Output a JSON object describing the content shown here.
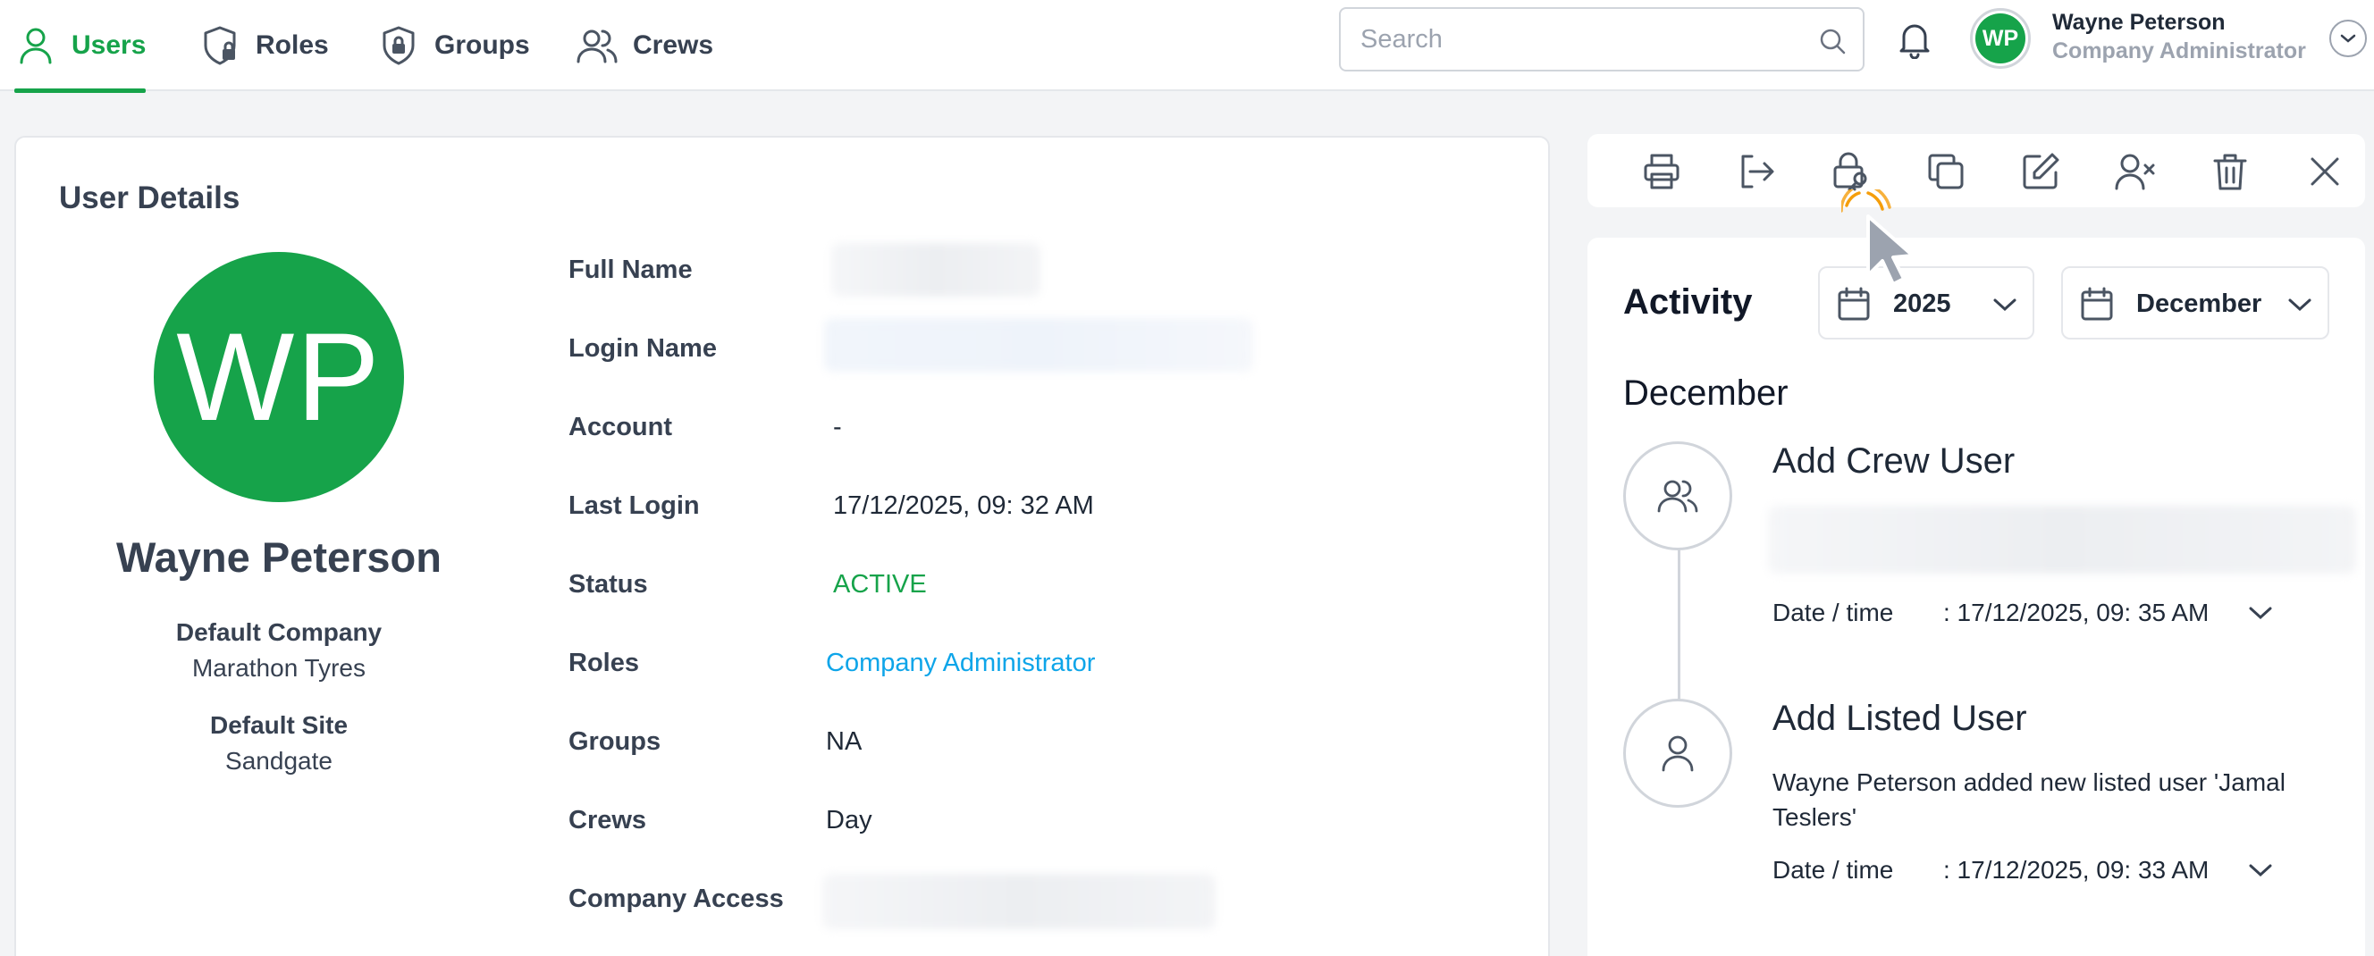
{
  "nav": {
    "tabs": [
      {
        "label": "Users",
        "icon": "user-icon",
        "active": true
      },
      {
        "label": "Roles",
        "icon": "shield-lock-icon",
        "active": false
      },
      {
        "label": "Groups",
        "icon": "shield-group-icon",
        "active": false
      },
      {
        "label": "Crews",
        "icon": "users-icon",
        "active": false
      }
    ]
  },
  "search": {
    "placeholder": "Search",
    "value": ""
  },
  "current_user": {
    "initials": "WP",
    "name": "Wayne Peterson",
    "role": "Company Administrator"
  },
  "details": {
    "title": "User Details",
    "initials": "WP",
    "name": "Wayne Peterson",
    "default_company_label": "Default Company",
    "default_company": "Marathon Tyres",
    "default_site_label": "Default Site",
    "default_site": "Sandgate",
    "fields": {
      "full_name_label": "Full Name",
      "login_name_label": "Login Name",
      "account_label": "Account",
      "account": "-",
      "last_login_label": "Last Login",
      "last_login": "17/12/2025, 09: 32 AM",
      "status_label": "Status",
      "status": "ACTIVE",
      "roles_label": "Roles",
      "roles": "Company Administrator",
      "groups_label": "Groups",
      "groups": "NA",
      "crews_label": "Crews",
      "crews": "Day",
      "company_access_label": "Company Access"
    }
  },
  "toolbar": {
    "tools": [
      "print-icon",
      "logout-icon",
      "lock-key-icon",
      "copy-icon",
      "edit-icon",
      "remove-user-icon",
      "trash-icon",
      "close-icon"
    ]
  },
  "activity": {
    "title": "Activity",
    "year": "2025",
    "month": "December",
    "month_heading": "December",
    "entries": [
      {
        "icon": "users-icon",
        "title": "Add Crew User",
        "description": "",
        "dt_label": "Date / time",
        "dt_value": ": 17/12/2025, 09: 35 AM"
      },
      {
        "icon": "user-icon",
        "title": "Add Listed User",
        "description": "Wayne Peterson added new listed user 'Jamal Teslers'",
        "dt_label": "Date / time",
        "dt_value": ": 17/12/2025, 09: 33 AM"
      }
    ]
  },
  "colors": {
    "accent": "#16a34a",
    "link": "#0ea5e9",
    "click_ring": "#f59e0b"
  }
}
